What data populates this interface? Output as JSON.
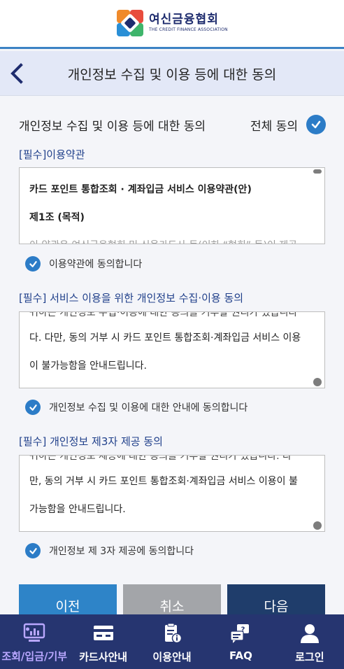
{
  "brand": {
    "name_kr": "여신금융협회",
    "name_en": "THE CREDIT FINANCE ASSOCIATION"
  },
  "header": {
    "title": "개인정보 수집 및 이용 등에 대한 동의"
  },
  "consent": {
    "section_title": "개인정보 수집 및 이용 등에 대한 동의",
    "all_agree_label": "전체 동의",
    "all_agree_checked": true
  },
  "terms": {
    "label": "[필수]이용약관",
    "box_title": "카드 포인트 통합조회 · 계좌입금 서비스 이용약관(안)",
    "box_article": "제1조 (목적)",
    "box_text_partial": "이 약관은 여신금융협회 및 신용카드사 등(이하 “협회” 등)이 제공",
    "agree_text": "이용약관에 동의합니다",
    "checked": true
  },
  "privacy_collect": {
    "label": "[필수] 서비스 이용을 위한 개인정보 수집·이용 동의",
    "line_cut": "귀하는 개인정보 수집·이용에 대한 동의를 거부할 권리가 있습니다",
    "line1": "다. 다만, 동의 거부 시 카드 포인트 통합조회·계좌입금 서비스 이용",
    "line2": "이 불가능함을 안내드립니다.",
    "agree_text": "개인정보 수집 및 이용에 대한 안내에 동의합니다",
    "checked": true
  },
  "privacy_third": {
    "label": "[필수] 개인정보 제3자 제공 동의",
    "line_cut": "귀하는 개인정보 제공에 대한 동의를 거부할 권리가 있습니다. 다",
    "line1": "만, 동의 거부 시 카드 포인트 통합조회·계좌입금 서비스 이용이 불",
    "line2": "가능함을 안내드립니다.",
    "agree_text": "개인정보 제 3자 제공에 동의합니다",
    "checked": true
  },
  "buttons": {
    "prev": "이전",
    "cancel": "취소",
    "next": "다음"
  },
  "tabs": [
    {
      "label": "조회/입금/기부",
      "icon": "monitor-chart-icon",
      "active": true
    },
    {
      "label": "카드사안내",
      "icon": "credit-card-icon",
      "active": false
    },
    {
      "label": "이용안내",
      "icon": "clipboard-info-icon",
      "active": false
    },
    {
      "label": "FAQ",
      "icon": "question-chat-icon",
      "active": false
    },
    {
      "label": "로그인",
      "icon": "user-icon",
      "active": false
    }
  ],
  "colors": {
    "brand_navy": "#263570",
    "accent_blue": "#2c7cc7",
    "label_blue": "#1f3f8a",
    "button_prev": "#2e84c8",
    "button_cancel": "#a3a5a9",
    "button_next": "#1f3d6b",
    "active_tab": "#b9a7ff"
  }
}
